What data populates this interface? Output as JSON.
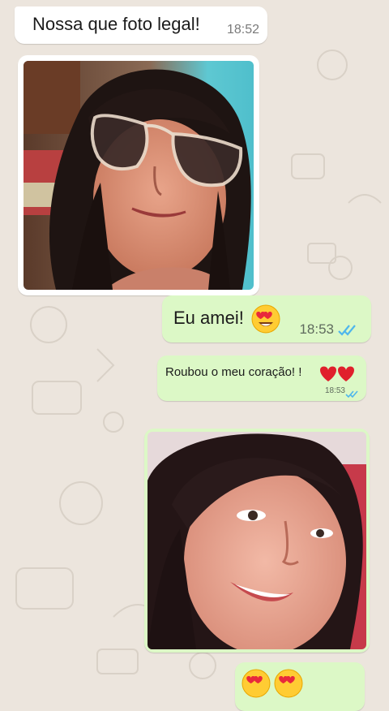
{
  "messages": [
    {
      "direction": "incoming",
      "type": "text",
      "text": "Nossa que foto legal!",
      "time": "18:52"
    },
    {
      "direction": "incoming",
      "type": "image",
      "alt": "selfie-sunglasses"
    },
    {
      "direction": "outgoing",
      "type": "text",
      "text": "Eu amei!",
      "emoji": "heart-eyes",
      "time": "18:53",
      "status": "read"
    },
    {
      "direction": "outgoing",
      "type": "text",
      "text": "Roubou o meu coração! !",
      "emoji": "two-red-hearts",
      "time": "18:53",
      "status": "read"
    },
    {
      "direction": "outgoing",
      "type": "image",
      "alt": "selfie-smile"
    },
    {
      "direction": "outgoing",
      "type": "emoji",
      "emoji": "heart-eyes x2"
    }
  ],
  "colors": {
    "incoming_bubble": "#ffffff",
    "outgoing_bubble": "#dcf8c6",
    "read_ticks": "#4fb6ec",
    "wallpaper": "#ece5dd"
  }
}
